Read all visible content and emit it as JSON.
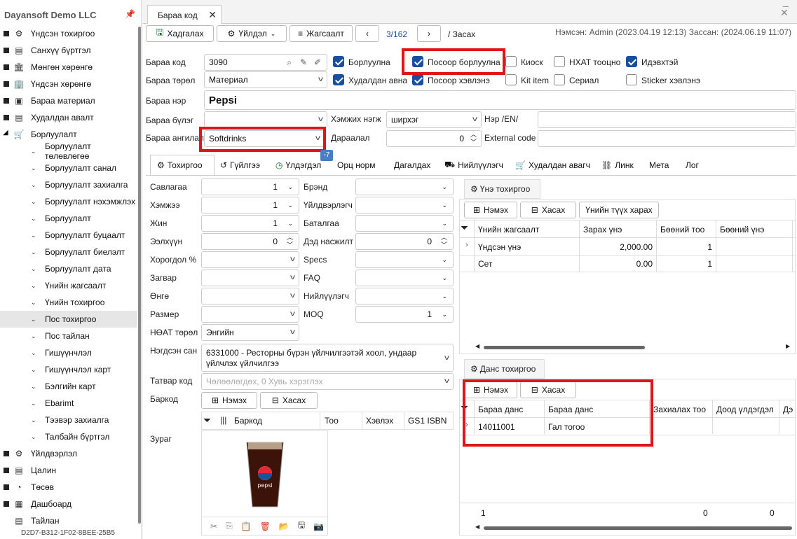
{
  "sidebar": {
    "company": "Dayansoft Demo LLC",
    "items": [
      {
        "label": "Үндсэн тохиргоо",
        "icon": "gear-icon"
      },
      {
        "label": "Санхүү бүртгэл",
        "icon": "ledger-icon"
      },
      {
        "label": "Мөнгөн хөрөнгө",
        "icon": "bank-icon"
      },
      {
        "label": "Үндсэн хөрөнгө",
        "icon": "building-icon"
      },
      {
        "label": "Бараа материал",
        "icon": "box-icon"
      },
      {
        "label": "Худалдан авалт",
        "icon": "purchase-icon"
      },
      {
        "label": "Борлуулалт",
        "icon": "cart-icon"
      }
    ],
    "sub_items": [
      "Борлуулалт төлөвлөгөө",
      "Борлуулалт санал",
      "Борлуулалт захиалга",
      "Борлуулалт нэхэмжлэх",
      "Борлуулалт",
      "Борлуулалт буцаалт",
      "Борлуулалт биелэлт",
      "Борлуулалт дата",
      "Үнийн жагсаалт",
      "Үнийн тохиргоо",
      "Пос тохиргоо",
      "Пос тайлан",
      "Гишүүнчлэл",
      "Гишүүнчлэл карт",
      "Бэлгийн карт",
      "Ebarimt",
      "Тээвэр захиалга",
      "Талбайн бүртгэл"
    ],
    "bottom_items": [
      {
        "label": "Үйлдвэрлэл",
        "icon": "factory-icon"
      },
      {
        "label": "Цалин",
        "icon": "salary-icon"
      },
      {
        "label": "Төсөв",
        "icon": "pie-icon"
      },
      {
        "label": "Дашбоард",
        "icon": "dashboard-icon"
      },
      {
        "label": "Тайлан",
        "icon": "report-icon"
      }
    ],
    "machine_id": "D2D7-B312-1F02-8BEE-25B5"
  },
  "doc_tab": "Бараа код",
  "toolbar": {
    "save": "Хадгалах",
    "actions": "Үйлдэл",
    "list": "Жагсаалт",
    "pager": "3/162",
    "mode": "/ Засах",
    "meta": "Нэмсэн: Admin (2023.04.19 12:13) Зассан:  (2024.06.19 11:07)"
  },
  "form": {
    "code_label": "Бараа код",
    "code_value": "3090",
    "type_label": "Бараа төрөл",
    "type_value": "Материал",
    "name_label": "Бараа нэр",
    "name_value": "Pepsi",
    "group_label": "Бараа бүлэг",
    "group_value": "",
    "category_label": "Бараа ангилал",
    "category_value": "Softdrinks",
    "unit_label": "Хэмжих нэгж",
    "unit_value": "ширхэг",
    "order_label": "Дараалал",
    "order_value": "0",
    "name_en_label": "Нэр /EN/",
    "extcode_label": "External code"
  },
  "checks": [
    {
      "label": "Борлуулна",
      "checked": true
    },
    {
      "label": "Посоор борлуулна",
      "checked": true
    },
    {
      "label": "Киоск",
      "checked": false
    },
    {
      "label": "НХАТ тооцно",
      "checked": false
    },
    {
      "label": "Идэвхтэй",
      "checked": true
    },
    {
      "label": "Худалдан авна",
      "checked": true
    },
    {
      "label": "Посоор хэвлэнэ",
      "checked": true
    },
    {
      "label": "Kit item",
      "checked": false
    },
    {
      "label": "Сериал",
      "checked": false
    },
    {
      "label": "Sticker хэвлэнэ",
      "checked": false
    }
  ],
  "badge": "-7",
  "tabs": [
    "Тохиргоо",
    "Гүйлгээ",
    "Үлдэгдэл",
    "Орц норм",
    "Дагалдах",
    "Нийлүүлэгч",
    "Худалдан авагч",
    "Линк",
    "Мета",
    "Лог"
  ],
  "settings_left": [
    {
      "label": "Савлагаа",
      "value": "1"
    },
    {
      "label": "Хэмжээ",
      "value": "1"
    },
    {
      "label": "Жин",
      "value": "1"
    },
    {
      "label": "Ээлхүүн",
      "value": "0"
    },
    {
      "label": "Хорогдол %",
      "value": ""
    },
    {
      "label": "Загвар",
      "value": ""
    },
    {
      "label": "Өнгө",
      "value": ""
    },
    {
      "label": "Размер",
      "value": ""
    },
    {
      "label": "НӨАТ төрөл",
      "value": "Энгийн"
    }
  ],
  "settings_right": [
    {
      "label": "Брэнд",
      "value": ""
    },
    {
      "label": "Үйлдвэрлэгч",
      "value": ""
    },
    {
      "label": "Баталгаа",
      "value": ""
    },
    {
      "label": "Дэд насжилт",
      "value": "0"
    },
    {
      "label": "Specs",
      "value": ""
    },
    {
      "label": "FAQ",
      "value": ""
    },
    {
      "label": "Нийлүүлэгч",
      "value": ""
    },
    {
      "label": "MOQ",
      "value": "1"
    }
  ],
  "tax_group": {
    "label": "Нэгдсэн сан",
    "value": "6331000 - Ресторны бүрэн үйлчилгээтэй хоол, ундаар үйлчлэх үйлчилгээ"
  },
  "tax_code": {
    "label": "Татвар код",
    "placeholder": "Чөлөөлөгдөх, 0 Хувь хэрэглэх"
  },
  "barcode": {
    "label": "Баркод",
    "add": "Нэмэх",
    "remove": "Хасах",
    "cols": [
      "Баркод",
      "Тоо",
      "Хэвлэх",
      "GS1 ISBN"
    ]
  },
  "image_label": "Зураг",
  "price": {
    "title": "Үнэ тохиргоо",
    "add": "Нэмэх",
    "remove": "Хасах",
    "history": "Үнийн түүх харах",
    "cols": [
      "Үнийн жагсаалт",
      "Зарах үнэ",
      "Бөөний тоо",
      "Бөөний үнэ"
    ],
    "rows": [
      [
        "Үндсэн үнэ",
        "2,000.00",
        "1",
        ""
      ],
      [
        "Сет",
        "0.00",
        "1",
        ""
      ]
    ]
  },
  "account": {
    "title": "Данс тохиргоо",
    "add": "Нэмэх",
    "remove": "Хасах",
    "cols": [
      "Бараа данс",
      "Бараа данс",
      "Захиалах тоо",
      "Доод үлдэгдэл",
      "Дэ"
    ],
    "rows": [
      [
        "14011001",
        "Гал тогоо",
        "",
        ""
      ]
    ],
    "footer": [
      "1",
      "0",
      "0"
    ]
  },
  "colors": {
    "accent": "#1a4fa0",
    "highlight": "#e0141b"
  }
}
